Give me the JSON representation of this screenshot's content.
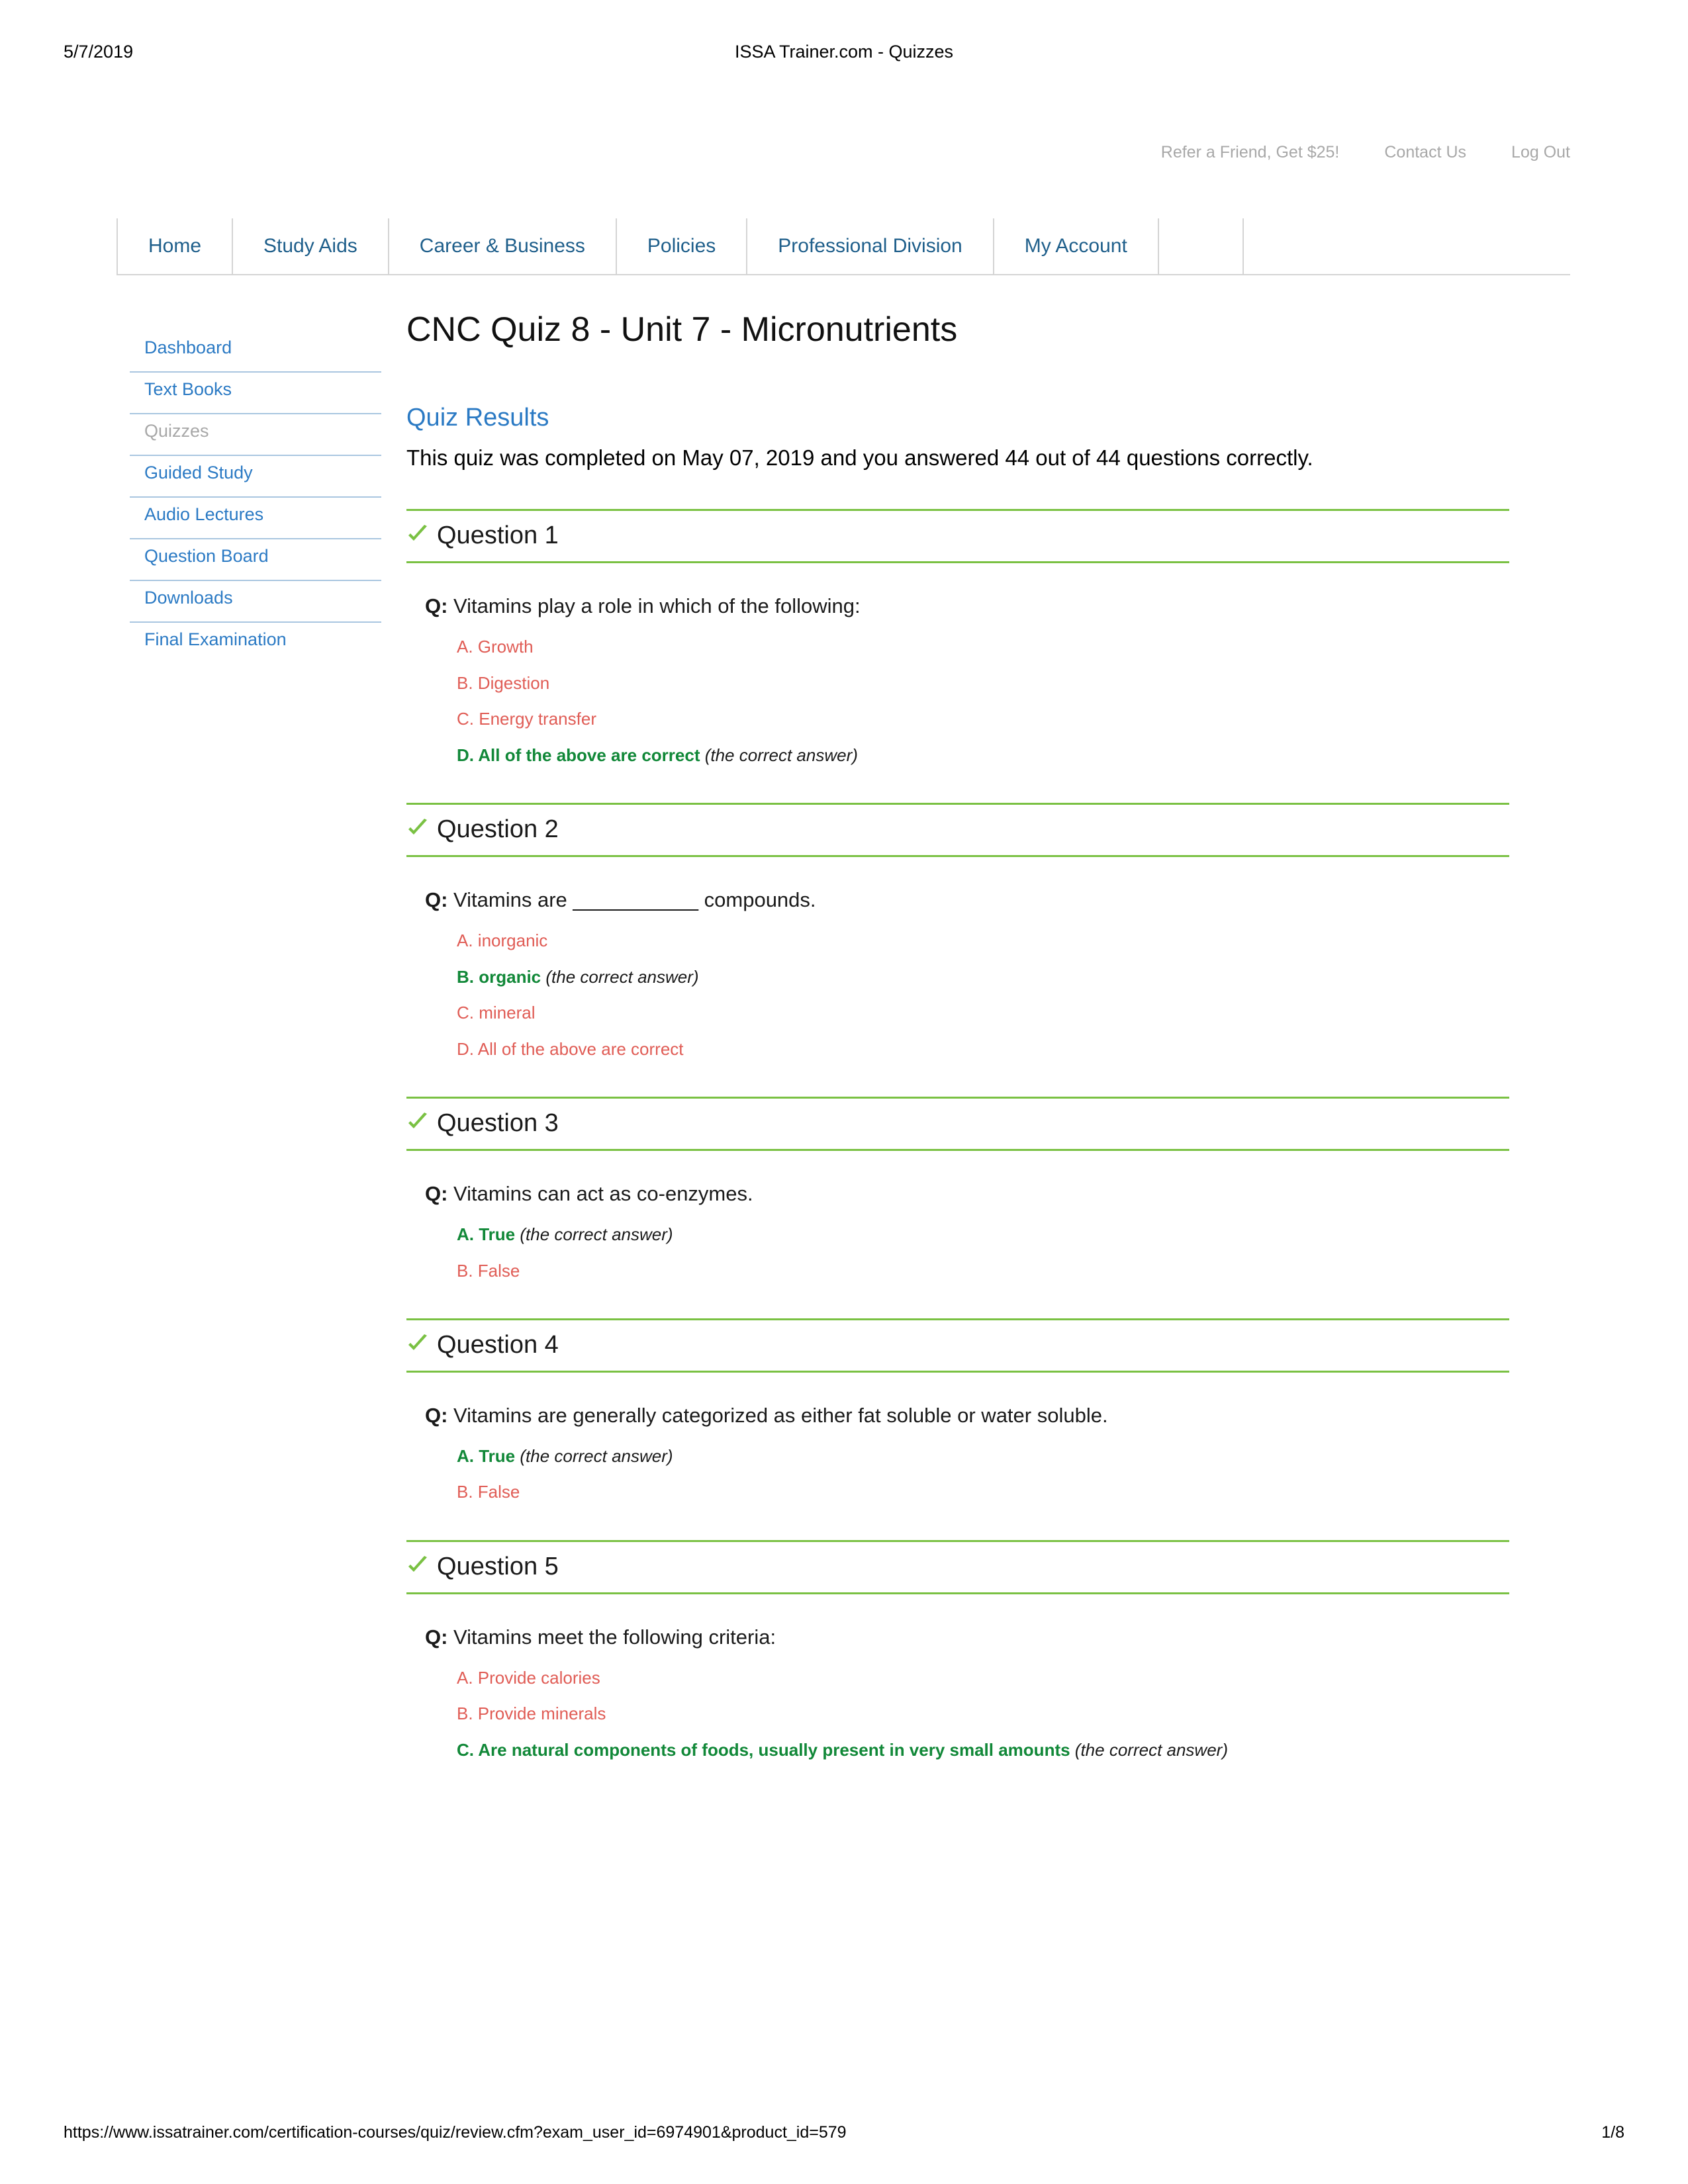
{
  "print": {
    "date": "5/7/2019",
    "doc_title": "ISSA Trainer.com - Quizzes",
    "footer_url": "https://www.issatrainer.com/certification-courses/quiz/review.cfm?exam_user_id=6974901&product_id=579",
    "page_number": "1/8"
  },
  "utility": {
    "links": [
      {
        "label": "Refer a Friend, Get $25!"
      },
      {
        "label": "Contact Us"
      },
      {
        "label": "Log Out"
      }
    ]
  },
  "nav": {
    "items": [
      {
        "label": "Home"
      },
      {
        "label": "Study Aids"
      },
      {
        "label": "Career & Business"
      },
      {
        "label": "Policies"
      },
      {
        "label": "Professional Division"
      },
      {
        "label": "My Account"
      }
    ]
  },
  "sidebar": {
    "items": [
      {
        "label": "Dashboard",
        "current": false
      },
      {
        "label": "Text Books",
        "current": false
      },
      {
        "label": "Quizzes",
        "current": true
      },
      {
        "label": "Guided Study",
        "current": false
      },
      {
        "label": "Audio Lectures",
        "current": false
      },
      {
        "label": "Question Board",
        "current": false
      },
      {
        "label": "Downloads",
        "current": false
      },
      {
        "label": "Final Examination",
        "current": false
      }
    ]
  },
  "main": {
    "page_title": "CNC Quiz 8 - Unit 7 - Micronutrients",
    "results_heading": "Quiz Results",
    "results_text": "This quiz was completed on May 07, 2019 and you answered 44 out of 44 questions correctly.",
    "question_marker": "Q:",
    "correct_tag": "(the correct answer)",
    "questions": [
      {
        "header": "Question 1",
        "text": "Vitamins play a role in which of the following:",
        "options": [
          {
            "label": "A. Growth",
            "correct": false
          },
          {
            "label": "B. Digestion",
            "correct": false
          },
          {
            "label": "C. Energy transfer",
            "correct": false
          },
          {
            "label": "D. All of the above are correct",
            "correct": true
          }
        ]
      },
      {
        "header": "Question 2",
        "text": "Vitamins are ___________ compounds.",
        "options": [
          {
            "label": "A. inorganic",
            "correct": false
          },
          {
            "label": "B. organic",
            "correct": true
          },
          {
            "label": "C. mineral",
            "correct": false
          },
          {
            "label": "D. All of the above are correct",
            "correct": false
          }
        ]
      },
      {
        "header": "Question 3",
        "text": "Vitamins can act as co-enzymes.",
        "options": [
          {
            "label": "A. True",
            "correct": true
          },
          {
            "label": "B. False",
            "correct": false
          }
        ]
      },
      {
        "header": "Question 4",
        "text": "Vitamins are generally categorized as either fat soluble or water soluble.",
        "options": [
          {
            "label": "A. True",
            "correct": true
          },
          {
            "label": "B. False",
            "correct": false
          }
        ]
      },
      {
        "header": "Question 5",
        "text": "Vitamins meet the following criteria:",
        "options": [
          {
            "label": "A. Provide calories",
            "correct": false
          },
          {
            "label": "B. Provide minerals",
            "correct": false
          },
          {
            "label": "C. Are natural components of foods, usually present in very small amounts",
            "correct": true
          }
        ]
      }
    ]
  },
  "colors": {
    "link_blue": "#2b7ac4",
    "nav_blue": "#1f5f8b",
    "correct_green": "#118838",
    "rule_green": "#7ac143",
    "incorrect_red": "#e05c55",
    "muted_gray": "#a8a8a8"
  }
}
